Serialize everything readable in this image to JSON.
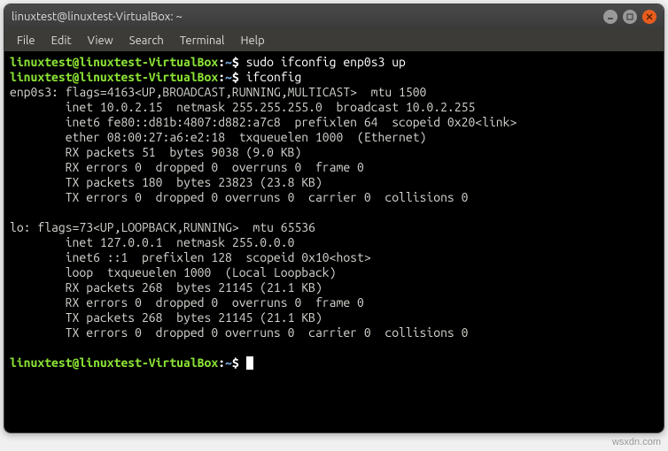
{
  "window": {
    "title": "linuxtest@linuxtest-VirtualBox: ~"
  },
  "menubar": {
    "items": [
      "File",
      "Edit",
      "View",
      "Search",
      "Terminal",
      "Help"
    ]
  },
  "prompt": {
    "user_host": "linuxtest@linuxtest-VirtualBox",
    "sep": ":",
    "path": "~",
    "end": "$"
  },
  "commands": {
    "c1": "sudo ifconfig enp0s3 up",
    "c2": "ifconfig"
  },
  "output": {
    "l1": "enp0s3: flags=4163<UP,BROADCAST,RUNNING,MULTICAST>  mtu 1500",
    "l2": "        inet 10.0.2.15  netmask 255.255.255.0  broadcast 10.0.2.255",
    "l3": "        inet6 fe80::d81b:4807:d882:a7c8  prefixlen 64  scopeid 0x20<link>",
    "l4": "        ether 08:00:27:a6:e2:18  txqueuelen 1000  (Ethernet)",
    "l5": "        RX packets 51  bytes 9038 (9.0 KB)",
    "l6": "        RX errors 0  dropped 0  overruns 0  frame 0",
    "l7": "        TX packets 180  bytes 23823 (23.8 KB)",
    "l8": "        TX errors 0  dropped 0 overruns 0  carrier 0  collisions 0",
    "l9": "",
    "l10": "lo: flags=73<UP,LOOPBACK,RUNNING>  mtu 65536",
    "l11": "        inet 127.0.0.1  netmask 255.0.0.0",
    "l12": "        inet6 ::1  prefixlen 128  scopeid 0x10<host>",
    "l13": "        loop  txqueuelen 1000  (Local Loopback)",
    "l14": "        RX packets 268  bytes 21145 (21.1 KB)",
    "l15": "        RX errors 0  dropped 0  overruns 0  frame 0",
    "l16": "        TX packets 268  bytes 21145 (21.1 KB)",
    "l17": "        TX errors 0  dropped 0 overruns 0  carrier 0  collisions 0",
    "l18": ""
  },
  "watermark": "wsxdn.com"
}
